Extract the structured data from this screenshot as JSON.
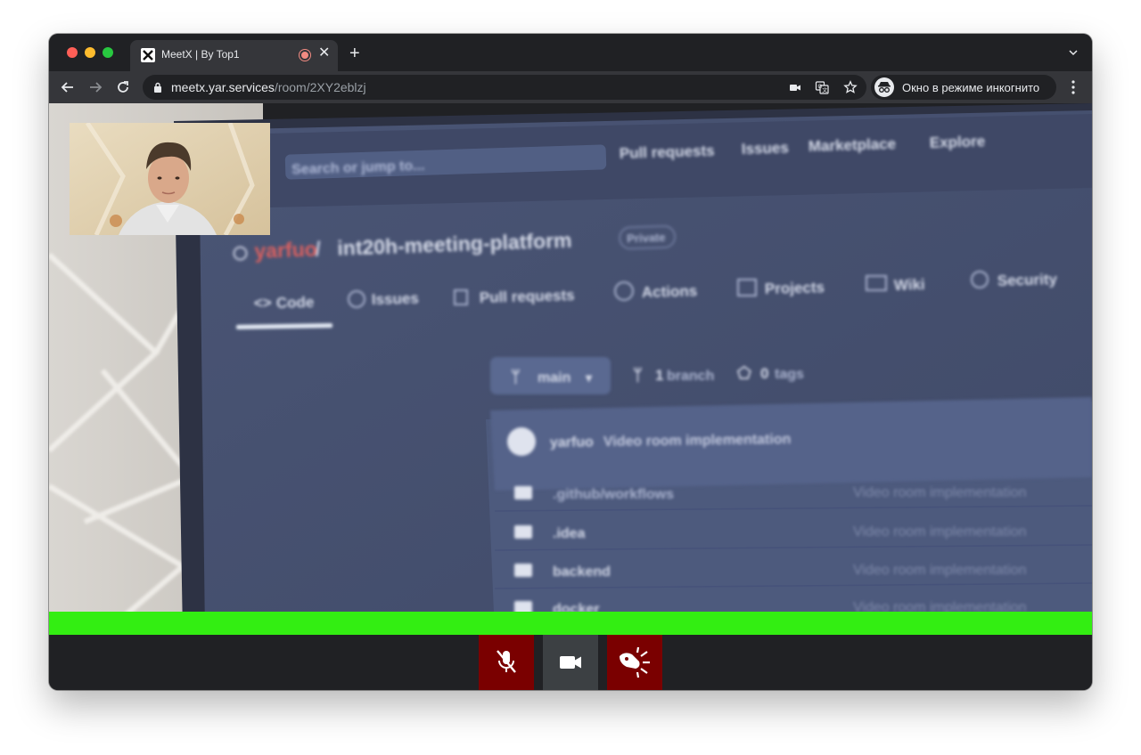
{
  "browser": {
    "tab": {
      "title": "MeetX | By Top1",
      "close_glyph": "✕"
    },
    "new_tab_glyph": "+",
    "url": {
      "host": "meetx.yar.services",
      "path": "/room/2XY2eblzj"
    },
    "incognito_label": "Окно в режиме инкогнито"
  },
  "screen_share": {
    "search_placeholder": "Search or jump to...",
    "top_nav": [
      "Pull requests",
      "Issues",
      "Marketplace",
      "Explore"
    ],
    "repo_owner": "yarfuo",
    "repo_separator": " / ",
    "repo_name": "int20h-meeting-platform",
    "visibility_badge": "Private",
    "repo_tabs": [
      "Code",
      "Issues",
      "Pull requests",
      "Actions",
      "Projects",
      "Wiki",
      "Security"
    ],
    "branch_button": "main",
    "branch_count": "1",
    "branch_word": "branch",
    "tag_count": "0",
    "tag_word": "tags",
    "latest_commit_author": "yarfuo",
    "latest_commit_message": "Video room implementation",
    "files": [
      {
        "name": ".github/workflows",
        "commit": "Video room implementation"
      },
      {
        "name": ".idea",
        "commit": "Video room implementation"
      },
      {
        "name": "backend",
        "commit": "Video room implementation"
      },
      {
        "name": "docker",
        "commit": "Video room implementation"
      }
    ]
  },
  "controls": {
    "mic_state": "muted",
    "camera_state": "on",
    "screen_share_state": "active"
  },
  "colors": {
    "speaking_indicator": "#33ee12",
    "control_active_red": "#7a0000",
    "control_neutral": "#3c4043"
  }
}
